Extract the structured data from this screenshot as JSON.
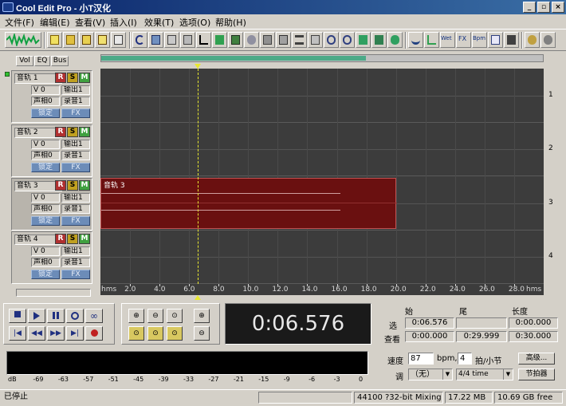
{
  "window": {
    "title": "Cool Edit Pro  - 小T汉化",
    "minimize": "_",
    "maximize": "▫",
    "close": "×"
  },
  "menu": [
    "文件(F)",
    "编辑(E)",
    "查看(V)",
    "插入(I)",
    "效果(T)",
    "选项(O)",
    "帮助(H)"
  ],
  "panel_tabs": [
    "Vol",
    "EQ",
    "Bus"
  ],
  "tracks": [
    {
      "name": "音轨  1",
      "vol": "V 0",
      "pan": "声相0",
      "out": "输出1",
      "rec": "录音1",
      "lock": "锁定",
      "fx": "FX"
    },
    {
      "name": "音轨  2",
      "vol": "V 0",
      "pan": "声相0",
      "out": "输出1",
      "rec": "录音1",
      "lock": "锁定",
      "fx": "FX"
    },
    {
      "name": "音轨  3",
      "vol": "V 0",
      "pan": "声相0",
      "out": "输出1",
      "rec": "录音1",
      "lock": "锁定",
      "fx": "FX"
    },
    {
      "name": "音轨  4",
      "vol": "V 0",
      "pan": "声相0",
      "out": "输出1",
      "rec": "录音1",
      "lock": "锁定",
      "fx": "FX"
    }
  ],
  "rsm": {
    "r": "R",
    "s": "S",
    "m": "M"
  },
  "clip": {
    "label": "音轨  3",
    "start_sec": 0,
    "end_sec": 20.0
  },
  "cursor_sec": 6.576,
  "overview_fraction": 0.6,
  "lane_numbers": [
    "1",
    "2",
    "3",
    "4"
  ],
  "ruler": {
    "unit": "hms",
    "ticks": [
      "2.0",
      "4.0",
      "6.0",
      "8.0",
      "10.0",
      "12.0",
      "14.0",
      "16.0",
      "18.0",
      "20.0",
      "22.0",
      "24.0",
      "26.0",
      "28.0"
    ],
    "unit_right": "hms"
  },
  "time_display": "0:06.576",
  "selection": {
    "headers": {
      "start": "始",
      "end": "尾",
      "length": "长度"
    },
    "sel_label": "选",
    "view_label": "查看",
    "sel_start": "0:06.576",
    "sel_end": "",
    "sel_length": "0:00.000",
    "view_start": "0:00.000",
    "view_end": "0:29.999",
    "view_length": "0:30.000"
  },
  "meter_labels": [
    "dB",
    "-69",
    "-63",
    "-57",
    "-51",
    "-45",
    "-39",
    "-33",
    "-27",
    "-21",
    "-15",
    "-9",
    "-6",
    "-3",
    "0"
  ],
  "tempo": {
    "speed_label": "速度",
    "bpm_value": "87",
    "bpm_unit": "bpm,",
    "beats_value": "4",
    "beats_label": "拍/小节",
    "advanced_btn": "高级...",
    "key_label": "调",
    "key_value": "（无）",
    "time_sig": "4/4 time",
    "metronome_btn": "节拍器"
  },
  "status": {
    "state": "已停止",
    "format": "44100 ?32-bit Mixing",
    "memory": "17.22 MB",
    "disk": "10.69 GB free"
  }
}
